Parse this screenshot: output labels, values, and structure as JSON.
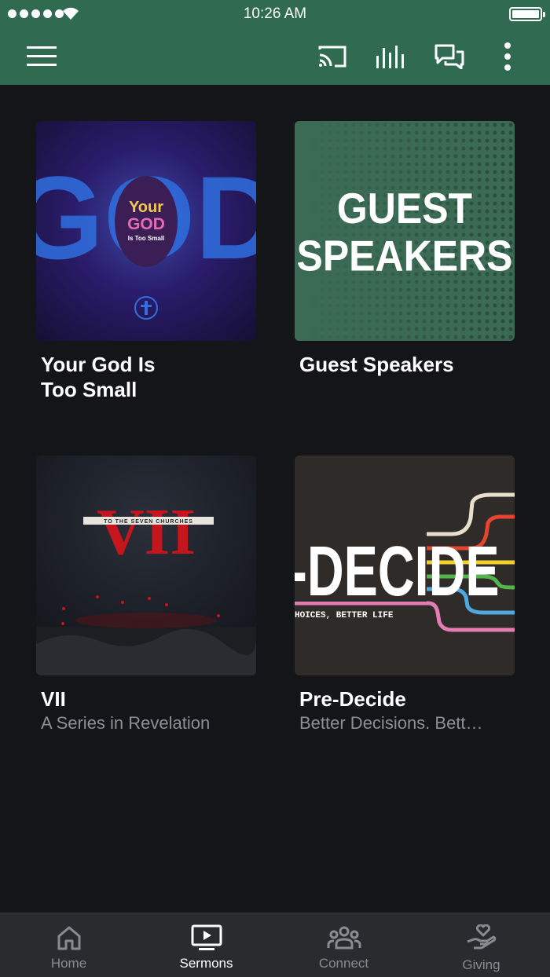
{
  "status_bar": {
    "time": "10:26 AM"
  },
  "app_bar": {
    "icons": [
      "menu-icon",
      "cast-icon",
      "equalizer-icon",
      "chat-icon",
      "more-vert-icon"
    ]
  },
  "series": [
    {
      "title_line1": "Your God Is",
      "title_line2": "Too Small",
      "subtitle": "",
      "art": {
        "big": "GOD",
        "small_top": "Your",
        "small_mid": "GOD",
        "small_bot": "Is Too Small"
      }
    },
    {
      "title_line1": "Guest Speakers",
      "title_line2": "",
      "subtitle": "",
      "art": {
        "line1": "GUEST",
        "line2": "SPEAKERS"
      }
    },
    {
      "title_line1": "VII",
      "title_line2": "",
      "subtitle": "A Series in Revelation",
      "art": {
        "numeral": "VII",
        "banner": "TO THE SEVEN CHURCHES"
      }
    },
    {
      "title_line1": "Pre-Decide",
      "title_line2": "",
      "subtitle": "Better Decisions. Bett…",
      "art": {
        "word": "-DECIDE",
        "tagline": "HOICES, BETTER LIFE"
      }
    }
  ],
  "tabs": [
    {
      "label": "Home",
      "icon": "home-icon",
      "active": false
    },
    {
      "label": "Sermons",
      "icon": "sermons-tv-icon",
      "active": true
    },
    {
      "label": "Connect",
      "icon": "connect-group-icon",
      "active": false
    },
    {
      "label": "Giving",
      "icon": "giving-hand-heart-icon",
      "active": false
    }
  ],
  "colors": {
    "brand": "#2f6a51",
    "background": "#141518",
    "tabbar": "#2a2b2f"
  }
}
